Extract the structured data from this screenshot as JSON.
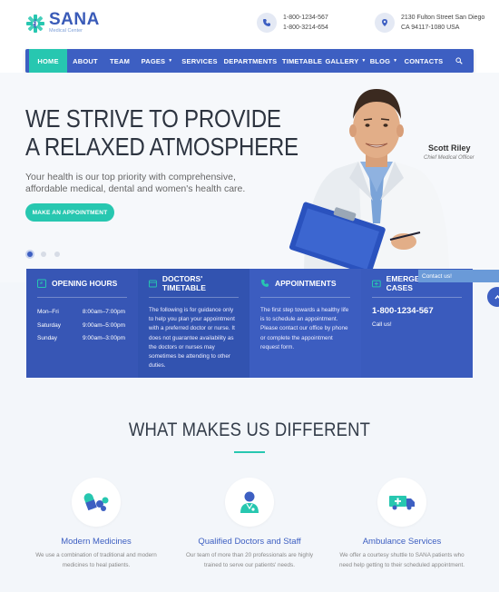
{
  "brand": {
    "name": "SANA",
    "tagline": "Medical Center"
  },
  "header": {
    "phone_lines": [
      "1-800-1234-567",
      "1-800-3214-654"
    ],
    "address_lines": [
      "2130 Fulton Street San Diego",
      "CA 94117-1080 USA"
    ]
  },
  "nav": {
    "items": [
      {
        "label": "HOME",
        "active": true
      },
      {
        "label": "ABOUT"
      },
      {
        "label": "TEAM"
      },
      {
        "label": "PAGES",
        "dropdown": true
      },
      {
        "label": "SERVICES"
      },
      {
        "label": "DEPARTMENTS"
      },
      {
        "label": "TIMETABLE"
      },
      {
        "label": "GALLERY",
        "dropdown": true
      },
      {
        "label": "BLOG",
        "dropdown": true
      },
      {
        "label": "CONTACTS"
      }
    ],
    "search_icon": "search-icon"
  },
  "hero": {
    "title_line1": "WE STRIVE TO PROVIDE",
    "title_line2": "A RELAXED ATMOSPHERE",
    "description": "Your health is our top priority with comprehensive, affordable medical, dental and women's health care.",
    "button": "MAKE AN APPOINTMENT",
    "doctor_name": "Scott Riley",
    "doctor_role": "Chief Medical Officer",
    "slide_count": 3,
    "active_slide": 1
  },
  "contact_tab": "Contact us!",
  "boxes": {
    "hours": {
      "title": "OPENING HOURS",
      "rows": [
        {
          "day": "Mon–Fri",
          "time": "8:00am–7:00pm"
        },
        {
          "day": "Saturday",
          "time": "9:00am–5:00pm"
        },
        {
          "day": "Sunday",
          "time": "9:00am–3:00pm"
        }
      ]
    },
    "timetable": {
      "title": "DOCTORS' TIMETABLE",
      "text": "The following is for guidance only to help you plan your appointment with a preferred doctor or nurse. It does not guarantee availability as the doctors or nurses may sometimes be attending to other duties."
    },
    "appointments": {
      "title": "APPOINTMENTS",
      "text": "The first step towards a healthy life is to schedule an appointment. Please contact our office by phone or complete the appointment request form."
    },
    "emergency": {
      "title": "EMERGENCY CASES",
      "phone": "1-800-1234-567",
      "sub": "Call us!"
    }
  },
  "section": {
    "title": "WHAT MAKES US DIFFERENT",
    "features": [
      {
        "icon": "pills-icon",
        "title": "Modern Medicines",
        "desc": "We use a combination of traditional and modern medicines to heal patients."
      },
      {
        "icon": "doctor-icon",
        "title": "Qualified Doctors and Staff",
        "desc": "Our team of more than 20 professionals are highly trained to serve our patients' needs."
      },
      {
        "icon": "ambulance-icon",
        "title": "Ambulance Services",
        "desc": "We offer a courtesy shuttle to SANA patients who need help getting to their scheduled appointment."
      }
    ]
  },
  "colors": {
    "primary": "#3d5fc2",
    "accent": "#27c7b0",
    "text_dark": "#2d3440"
  }
}
